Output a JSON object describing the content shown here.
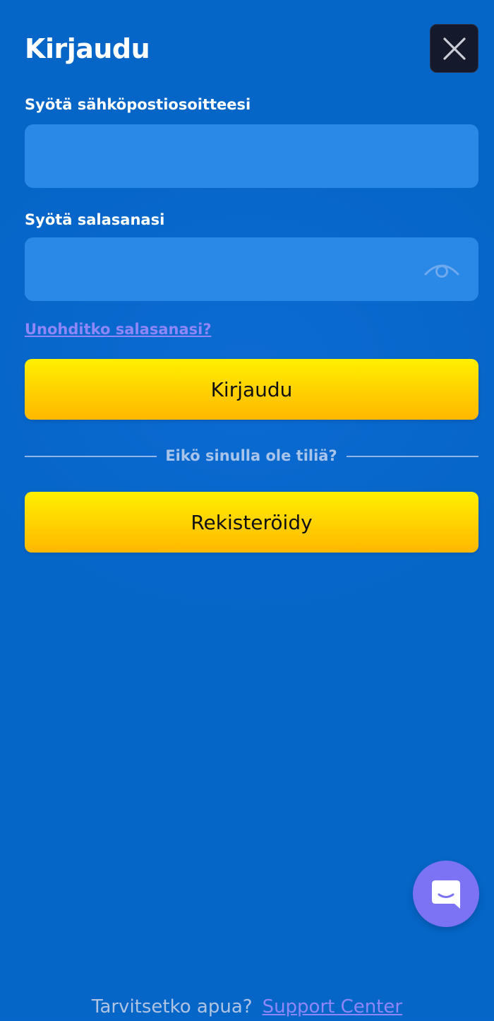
{
  "header": {
    "title": "Kirjaudu"
  },
  "form": {
    "email_label": "Syötä sähköpostiosoitteesi",
    "email_value": "",
    "password_label": "Syötä salasanasi",
    "password_value": "",
    "forgot_link": "Unohditko salasanasi?",
    "login_button": "Kirjaudu",
    "divider_text": "Eikö sinulla ole tiliä?",
    "register_button": "Rekisteröidy"
  },
  "footer": {
    "question": "Tarvitsetko apua?",
    "support_link": "Support Center"
  },
  "icons": {
    "close": "close-icon",
    "eye": "eye-icon",
    "chat": "chat-icon"
  },
  "colors": {
    "background": "#0766C9",
    "input_background": "#2A88E6",
    "button_yellow": "#FFD000",
    "link_purple": "#8F86F8",
    "close_button": "#141A2B",
    "chat_bubble": "#7B72F4"
  }
}
